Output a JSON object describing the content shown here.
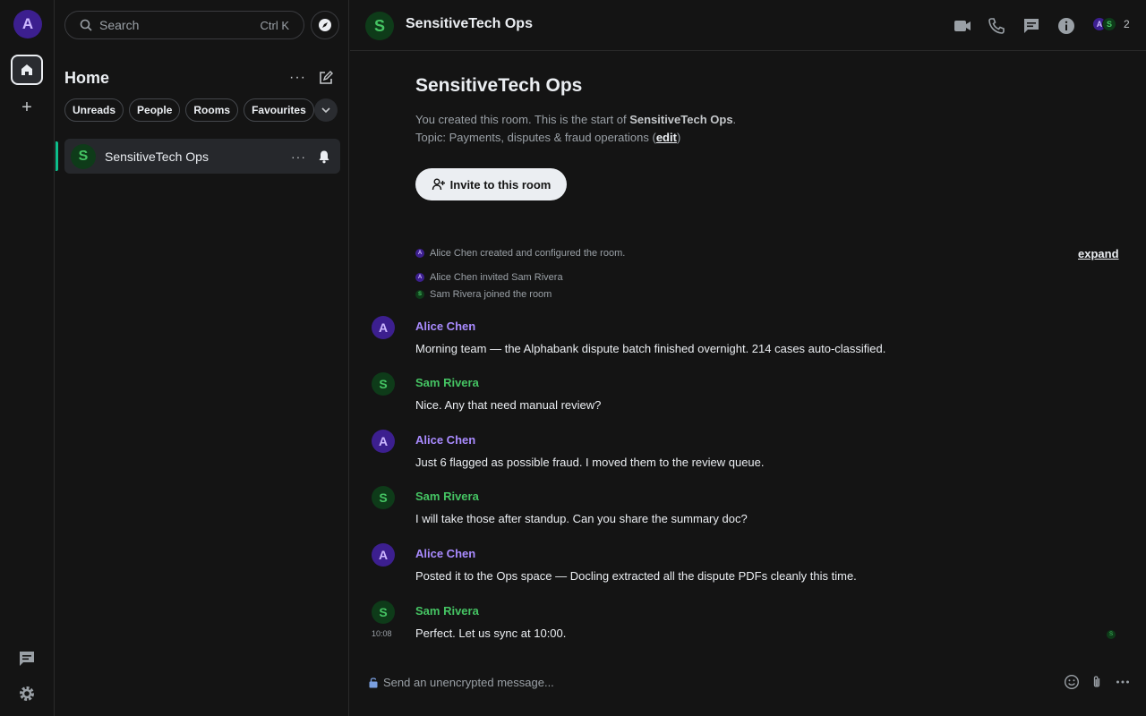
{
  "user": {
    "avatar_initial": "A"
  },
  "spacebar": {
    "add_label": "+"
  },
  "search": {
    "placeholder": "Search",
    "shortcut": "Ctrl K"
  },
  "roomlist": {
    "title": "Home",
    "more_label": "···",
    "filters": [
      "Unreads",
      "People",
      "Rooms",
      "Favourites"
    ],
    "rooms": [
      {
        "initial": "S",
        "name": "SensitiveTech Ops",
        "more_label": "···"
      }
    ]
  },
  "header": {
    "initial": "S",
    "name": "SensitiveTech Ops",
    "facepile": [
      "A",
      "S"
    ],
    "member_count": "2"
  },
  "intro": {
    "title": "SensitiveTech Ops",
    "created_prefix": "You created this room. This is the start of ",
    "created_room": "SensitiveTech Ops",
    "created_suffix": ".",
    "topic_prefix": "Topic: Payments, disputes & fraud operations (",
    "topic_edit": "edit",
    "topic_suffix": ")",
    "invite_label": "Invite to this room"
  },
  "events": {
    "summary": "Alice Chen created and configured the room.",
    "expand_label": "expand",
    "lines": [
      {
        "initial": "A",
        "text": "Alice Chen invited Sam Rivera"
      },
      {
        "initial": "S",
        "text": "Sam Rivera joined the room"
      }
    ]
  },
  "messages": [
    {
      "initial": "A",
      "sender": "Alice Chen",
      "body": "Morning team — the Alphabank dispute batch finished overnight. 214 cases auto-classified.",
      "time": ""
    },
    {
      "initial": "S",
      "sender": "Sam Rivera",
      "body": "Nice. Any that need manual review?",
      "time": ""
    },
    {
      "initial": "A",
      "sender": "Alice Chen",
      "body": "Just 6 flagged as possible fraud. I moved them to the review queue.",
      "time": ""
    },
    {
      "initial": "S",
      "sender": "Sam Rivera",
      "body": "I will take those after standup. Can you share the summary doc?",
      "time": ""
    },
    {
      "initial": "A",
      "sender": "Alice Chen",
      "body": "Posted it to the Ops space — Docling extracted all the dispute PDFs cleanly this time.",
      "time": ""
    },
    {
      "initial": "S",
      "sender": "Sam Rivera",
      "body": "Perfect. Let us sync at 10:00.",
      "time": "10:08"
    }
  ],
  "read_receipt": {
    "initial": "S"
  },
  "composer": {
    "placeholder": "Send an unencrypted message..."
  },
  "colors": {
    "accent": "#0dbd8b",
    "alice": "#a98bff",
    "sam": "#45c463",
    "background": "#141414"
  }
}
